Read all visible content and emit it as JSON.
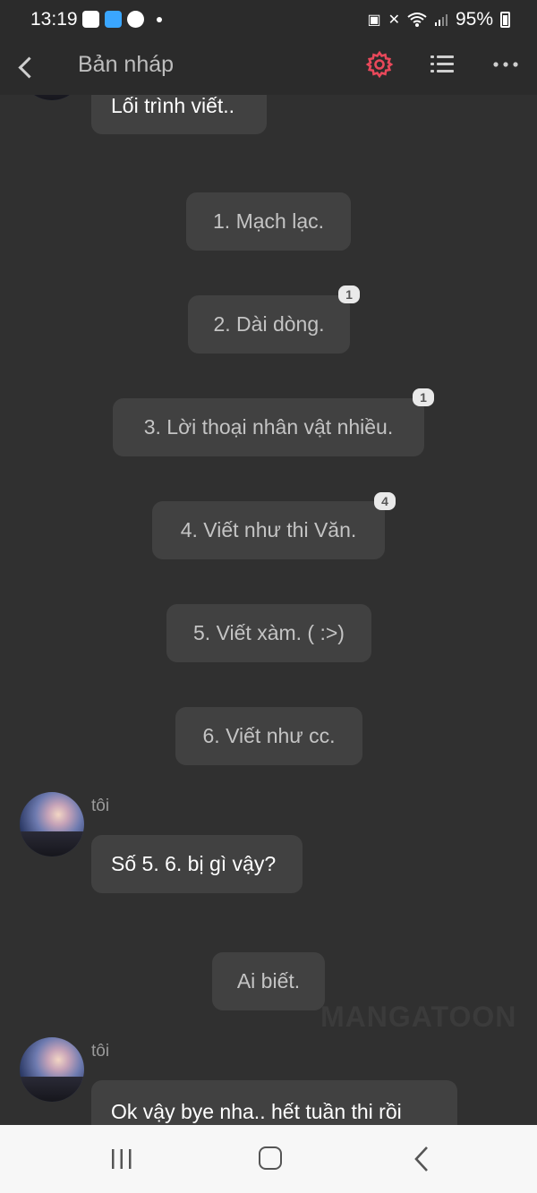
{
  "status_bar": {
    "time": "13:19",
    "battery": "95%",
    "left_icons": [
      "gallery-icon",
      "app-icon",
      "facebook-icon",
      "dot-icon"
    ],
    "right_icons": [
      "battery-saver-icon",
      "mute-icon",
      "wifi-icon",
      "signal-icon",
      "battery-icon"
    ]
  },
  "header": {
    "title": "Bản nháp",
    "accent_color": "#e8485a"
  },
  "messages": [
    {
      "text": "Lối trình viết..",
      "author": "me"
    },
    {
      "text": "1. Mạch lạc.",
      "author": "other"
    },
    {
      "text": "2. Dài dòng.",
      "author": "other",
      "badge": "1"
    },
    {
      "text": "3. Lời thoại nhân vật nhiều.",
      "author": "other",
      "badge": "1"
    },
    {
      "text": "4. Viết như thi Văn.",
      "author": "other",
      "badge": "4"
    },
    {
      "text": "5. Viết xàm. ( :>)",
      "author": "other"
    },
    {
      "text": "6. Viết như cc.",
      "author": "other"
    },
    {
      "sender": "tôi",
      "text": "Số 5. 6. bị gì vậy?",
      "author": "me"
    },
    {
      "text": "Ai biết.",
      "author": "other"
    },
    {
      "sender": "tôi",
      "text": "Ok vậy bye nha.. hết tuần thi rồi",
      "author": "me"
    }
  ],
  "watermark": "MANGATOON",
  "nav_bar": {
    "buttons": [
      "recent-apps",
      "home",
      "back"
    ]
  }
}
